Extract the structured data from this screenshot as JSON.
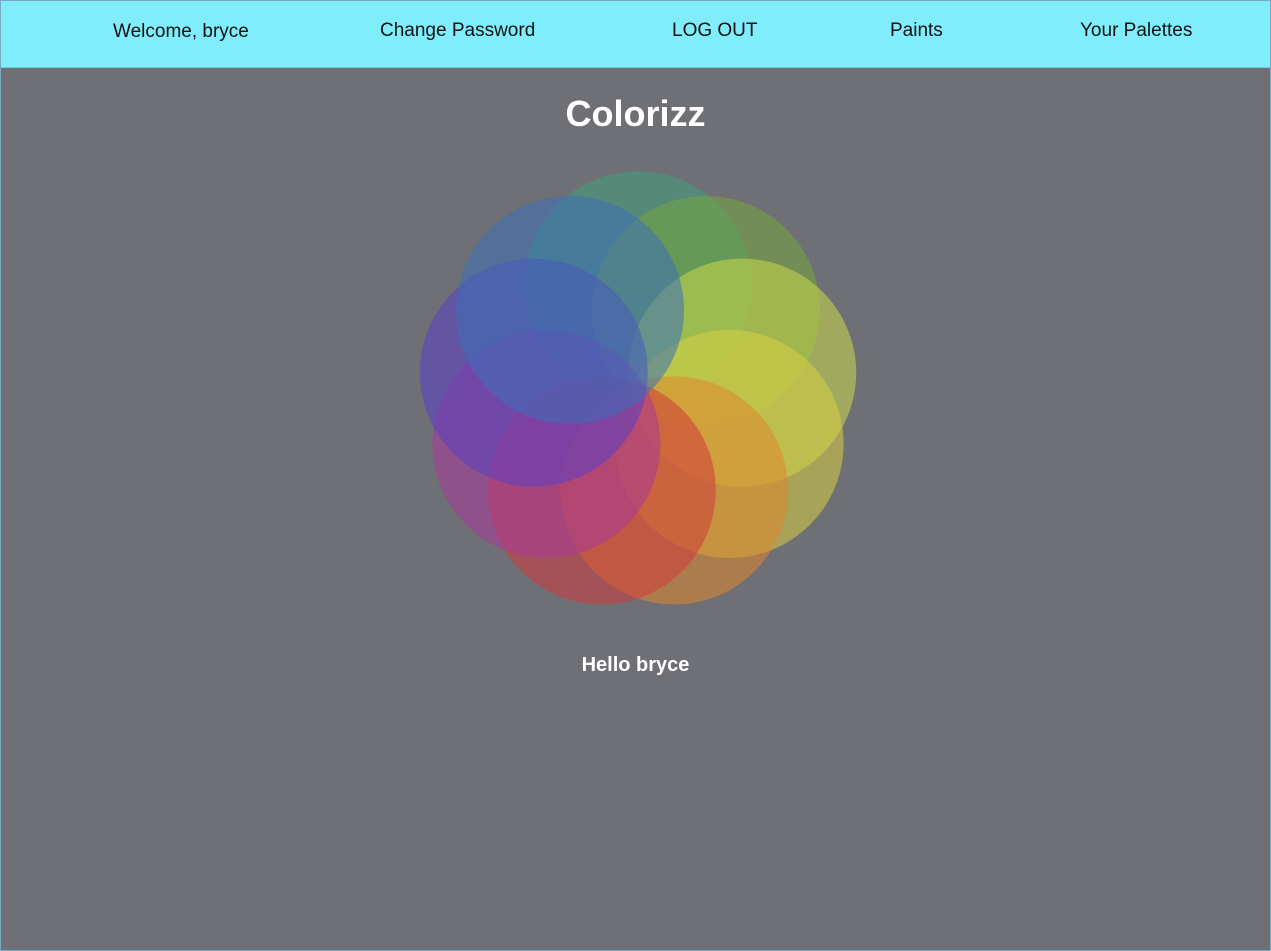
{
  "nav": {
    "welcome": "Welcome, bryce",
    "change_password": "Change Password",
    "logout": "LOG OUT",
    "paints": "Paints",
    "palettes": "Your Palettes"
  },
  "main": {
    "title": "Colorizz",
    "greeting": "Hello bryce"
  },
  "colors": {
    "navbar": "#7fedfb",
    "background": "#6f7075",
    "petals": [
      "#c9d84a",
      "#d6cf42",
      "#e0862d",
      "#cf3a3a",
      "#a8399a",
      "#5a3fc4",
      "#3c6fb8",
      "#3fa07a",
      "#74a53d"
    ]
  }
}
